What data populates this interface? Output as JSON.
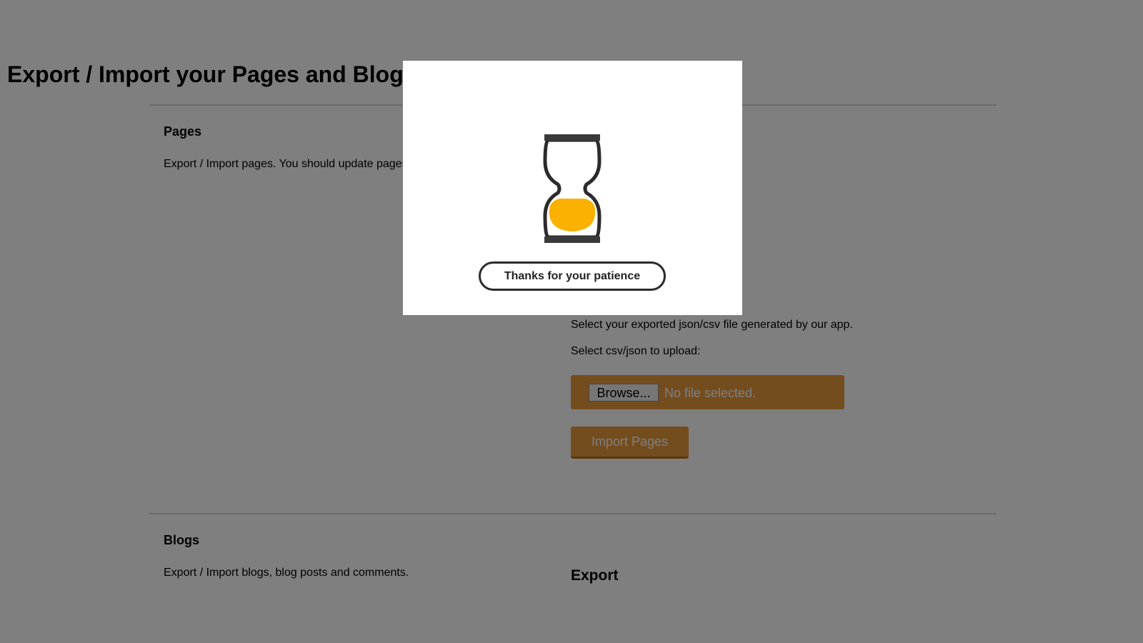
{
  "page": {
    "title": "Export / Import your Pages and Blogs"
  },
  "sections": {
    "pages": {
      "title": "Pages",
      "description": "Export / Import pages. You should update pages content by hand."
    },
    "blogs": {
      "title": "Blogs",
      "description": "Export / Import blogs, blog posts and comments."
    }
  },
  "import": {
    "hint": "Select your exported json/csv file generated by our app.",
    "upload_label": "Select csv/json to upload:",
    "browse_label": "Browse...",
    "file_status": "No file selected.",
    "import_button": "Import Pages"
  },
  "export": {
    "heading": "Export"
  },
  "modal": {
    "message": "Thanks for your patience",
    "icon": "hourglass-icon"
  },
  "colors": {
    "accent": "#e99a3f",
    "hourglass_fill": "#fbb100",
    "overlay": "rgba(0,0,0,0.5)"
  }
}
